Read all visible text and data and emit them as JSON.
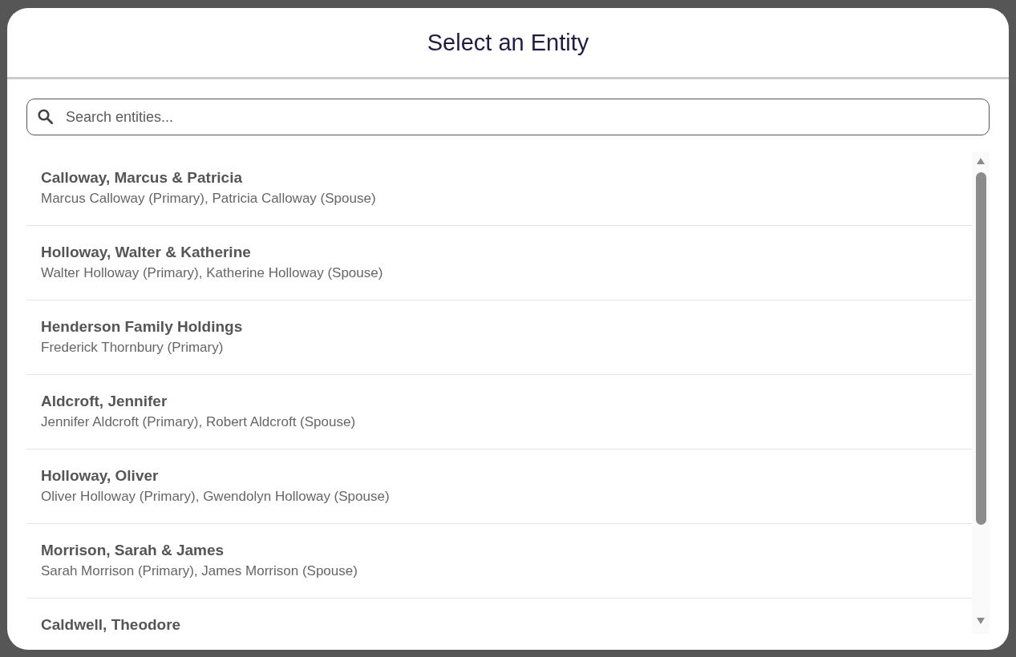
{
  "dialog": {
    "title": "Select an Entity"
  },
  "search": {
    "placeholder": "Search entities..."
  },
  "entities": [
    {
      "name": "Calloway, Marcus & Patricia",
      "members": "Marcus Calloway (Primary), Patricia Calloway (Spouse)"
    },
    {
      "name": "Holloway, Walter & Katherine",
      "members": "Walter Holloway (Primary), Katherine Holloway (Spouse)"
    },
    {
      "name": "Henderson Family Holdings",
      "members": "Frederick Thornbury (Primary)"
    },
    {
      "name": "Aldcroft, Jennifer",
      "members": "Jennifer Aldcroft (Primary), Robert Aldcroft (Spouse)"
    },
    {
      "name": "Holloway, Oliver",
      "members": "Oliver Holloway (Primary), Gwendolyn Holloway (Spouse)"
    },
    {
      "name": "Morrison, Sarah & James",
      "members": "Sarah Morrison (Primary), James Morrison (Spouse)"
    },
    {
      "name": "Caldwell, Theodore"
    }
  ]
}
